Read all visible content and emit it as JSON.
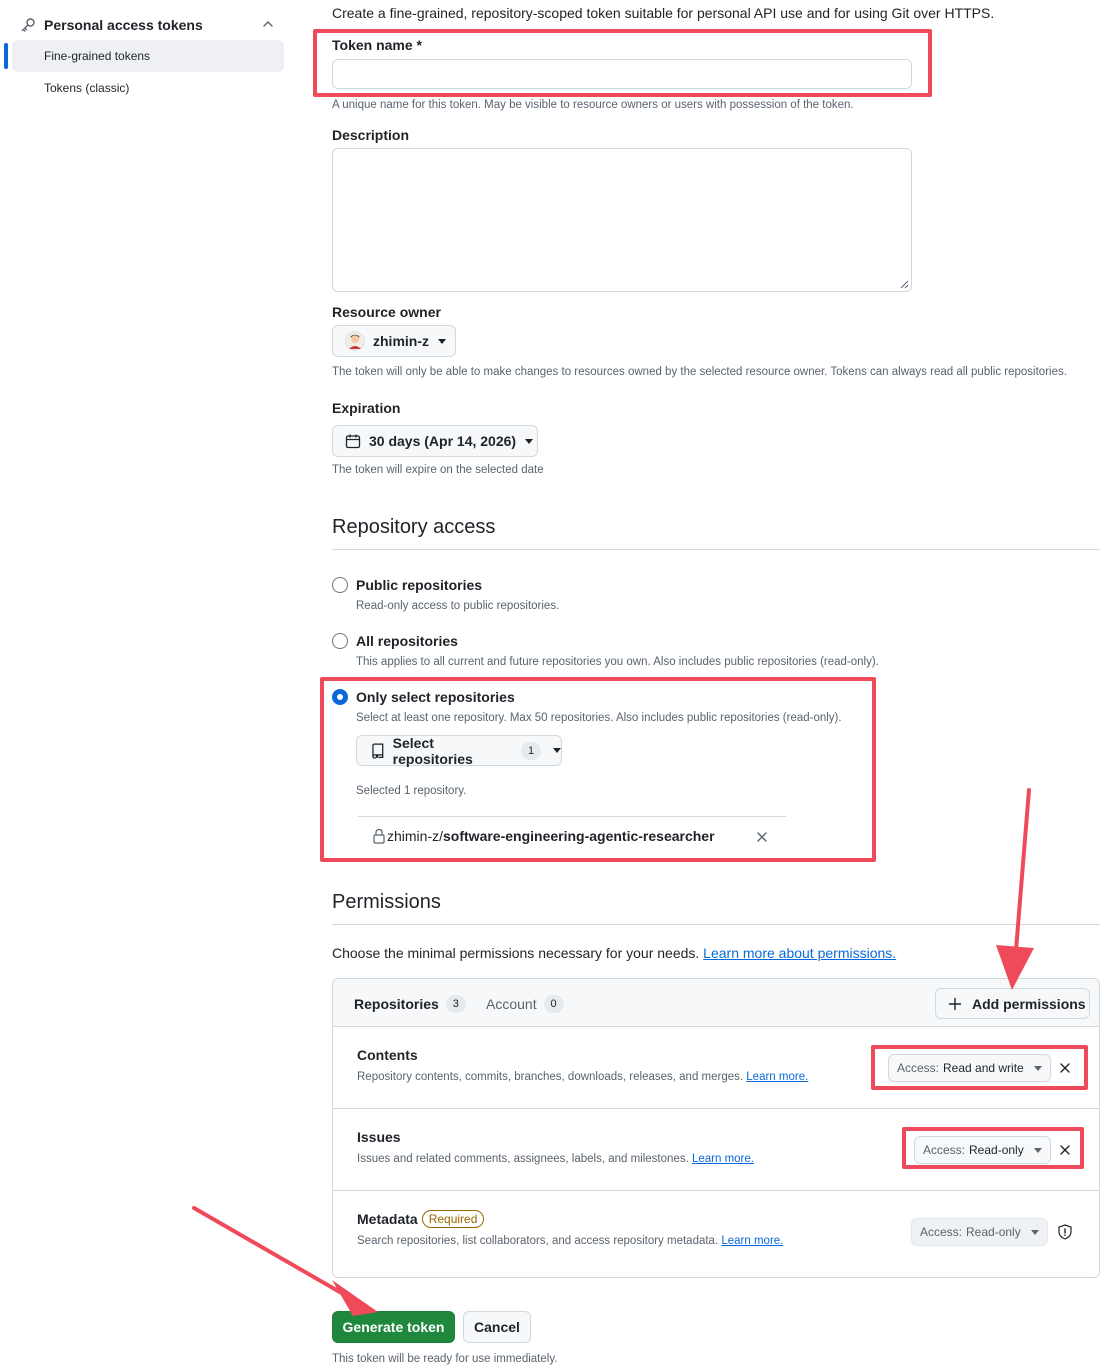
{
  "sidebar": {
    "section_title": "Personal access tokens",
    "items": [
      {
        "label": "Fine-grained tokens",
        "active": true
      },
      {
        "label": "Tokens (classic)",
        "active": false
      }
    ]
  },
  "intro": "Create a fine-grained, repository-scoped token suitable for personal API use and for using Git over HTTPS.",
  "token_name": {
    "label": "Token name *",
    "value": "",
    "help": "A unique name for this token. May be visible to resource owners or users with possession of the token."
  },
  "description": {
    "label": "Description",
    "value": ""
  },
  "resource_owner": {
    "label": "Resource owner",
    "selected": "zhimin-z",
    "help": "The token will only be able to make changes to resources owned by the selected resource owner. Tokens can always read all public repositories."
  },
  "expiration": {
    "label": "Expiration",
    "selected": "30 days (Apr 14, 2026)",
    "help": "The token will expire on the selected date"
  },
  "repository_access": {
    "title": "Repository access",
    "options": [
      {
        "label": "Public repositories",
        "help": "Read-only access to public repositories.",
        "checked": false
      },
      {
        "label": "All repositories",
        "help": "This applies to all current and future repositories you own. Also includes public repositories (read-only).",
        "checked": false
      },
      {
        "label": "Only select repositories",
        "help": "Select at least one repository. Max 50 repositories. Also includes public repositories (read-only).",
        "checked": true
      }
    ],
    "select_button": "Select repositories",
    "select_count": "1",
    "selected_summary": "Selected 1 repository.",
    "selected_repo_owner": "zhimin-z/",
    "selected_repo_name": "software-engineering-agentic-researcher"
  },
  "permissions": {
    "title": "Permissions",
    "intro": "Choose the minimal permissions necessary for your needs.",
    "learn_link": "Learn more about permissions.",
    "tabs": [
      {
        "label": "Repositories",
        "count": "3"
      },
      {
        "label": "Account",
        "count": "0"
      }
    ],
    "add_button": "Add permissions",
    "access_prefix": "Access:",
    "learn_more": "Learn more.",
    "rows": [
      {
        "name": "Contents",
        "badge": "",
        "desc": "Repository contents, commits, branches, downloads, releases, and merges.",
        "access": "Read and write"
      },
      {
        "name": "Issues",
        "badge": "",
        "desc": "Issues and related comments, assignees, labels, and milestones.",
        "access": "Read-only"
      },
      {
        "name": "Metadata",
        "badge": "Required",
        "desc": "Search repositories, list collaborators, and access repository metadata.",
        "access": "Read-only"
      }
    ]
  },
  "actions": {
    "generate": "Generate token",
    "cancel": "Cancel",
    "footnote": "This token will be ready for use immediately."
  },
  "colors": {
    "accent": "#0969da",
    "primary_button": "#1f883d",
    "annotation": "#ef4a59"
  }
}
